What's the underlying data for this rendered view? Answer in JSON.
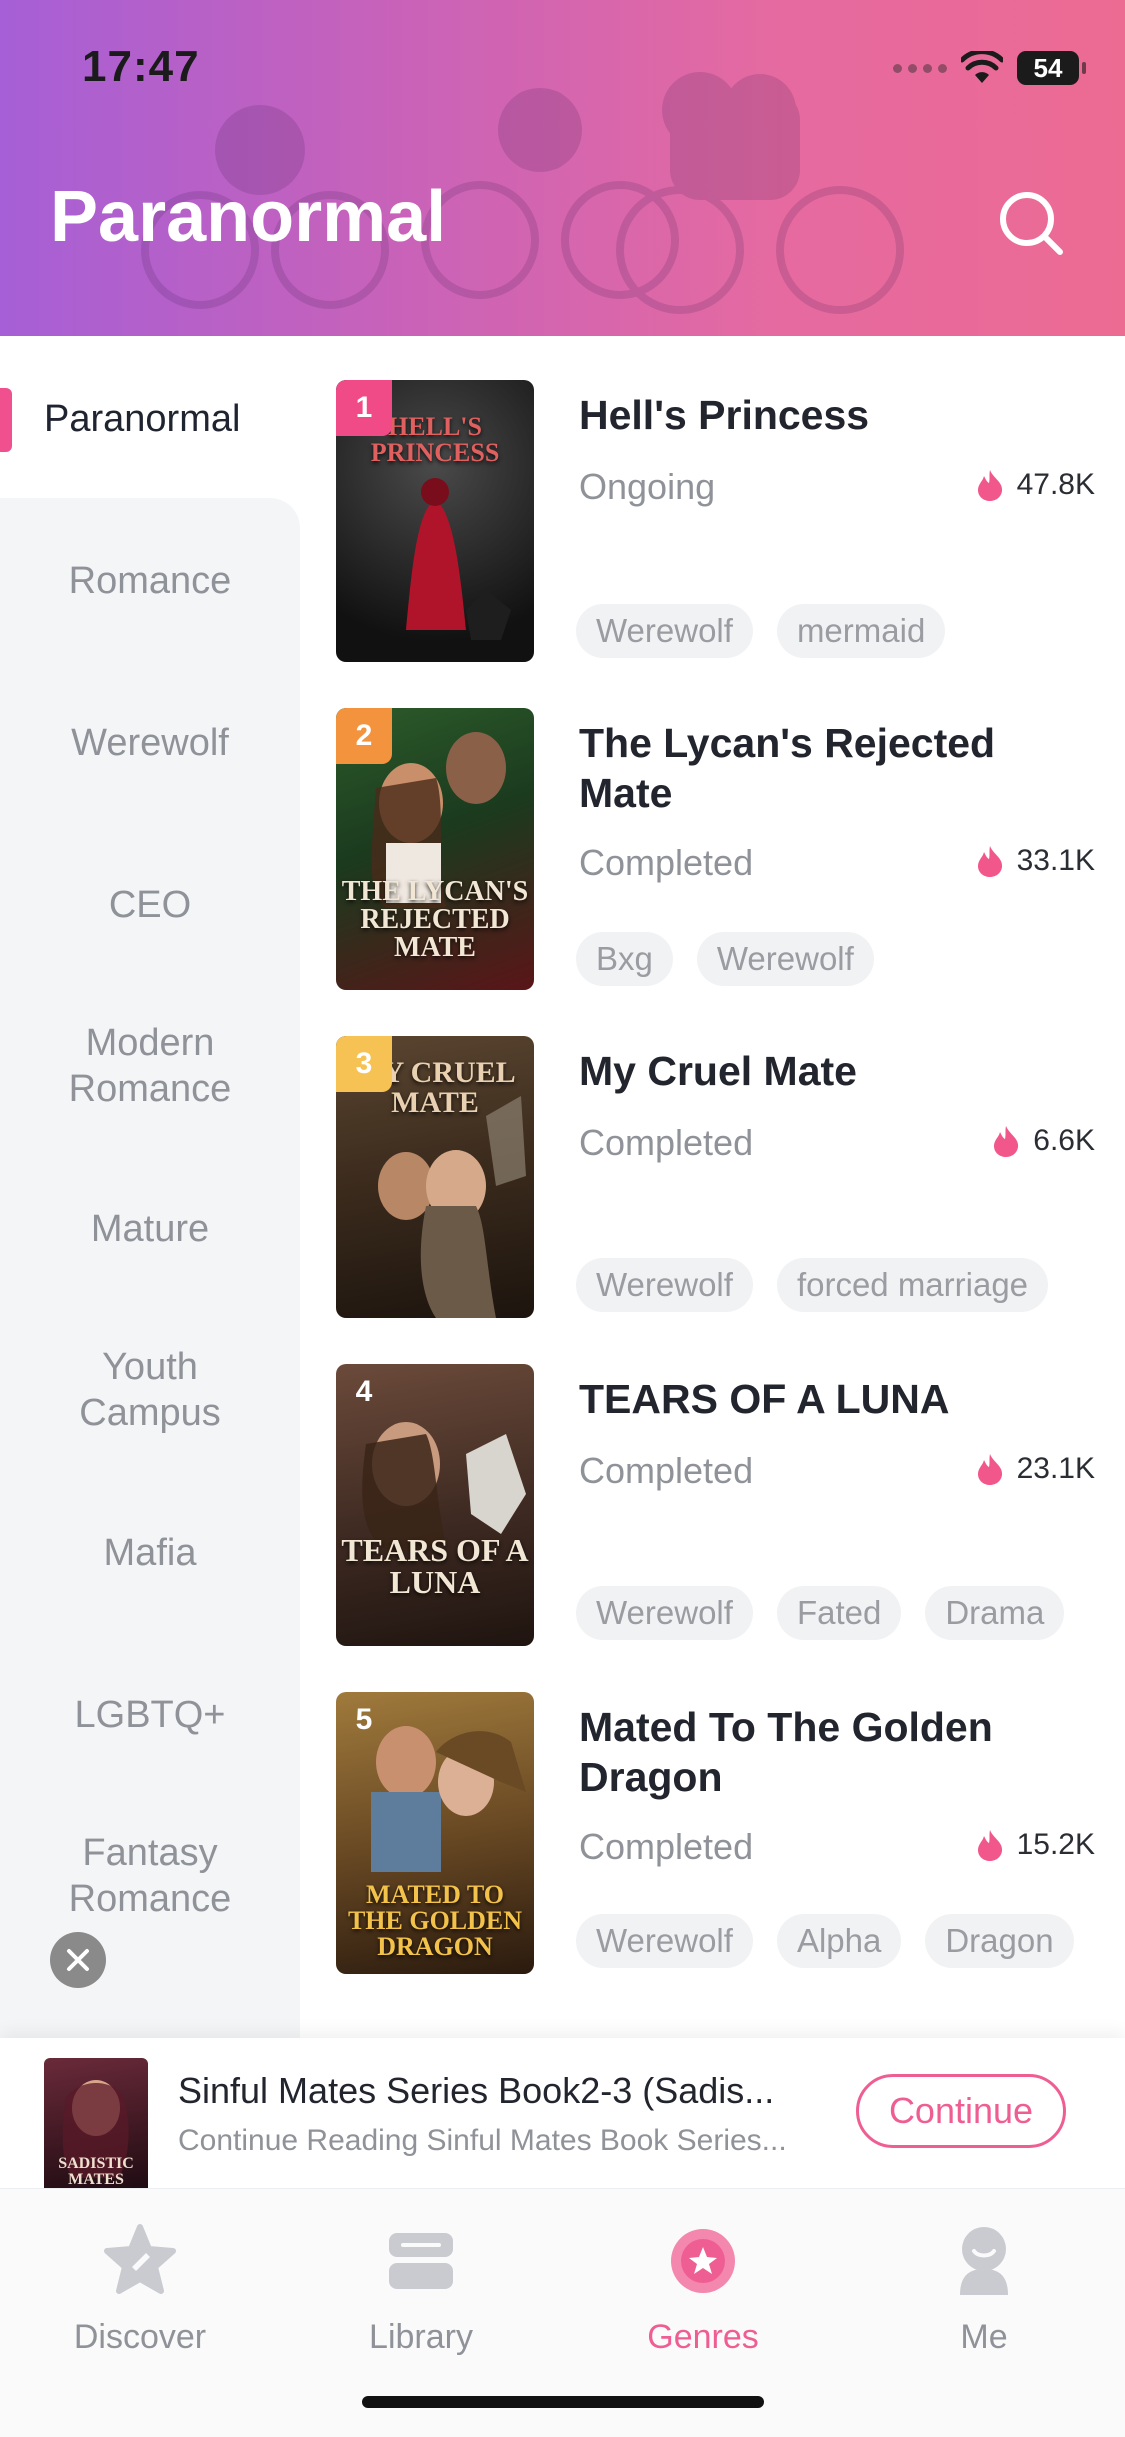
{
  "status_bar": {
    "time": "17:47",
    "battery": "54"
  },
  "header": {
    "title": "Paranormal"
  },
  "sidebar": {
    "active": "Paranormal",
    "items": [
      "Romance",
      "Werewolf",
      "CEO",
      "Modern Romance",
      "Mature",
      "Youth Campus",
      "Mafia",
      "LGBTQ+",
      "Fantasy Romance"
    ]
  },
  "books": [
    {
      "rank": "1",
      "title": "Hell's Princess",
      "status": "Ongoing",
      "views": "47.8K",
      "tags": [
        "Werewolf",
        "mermaid"
      ],
      "cover_text": "HELL'S PRINCESS",
      "rank_color": "#f04b86"
    },
    {
      "rank": "2",
      "title": "The Lycan's Rejected Mate",
      "status": "Completed",
      "views": "33.1K",
      "tags": [
        "Bxg",
        "Werewolf"
      ],
      "cover_text": "THE LYCAN'S REJECTED MATE",
      "rank_color": "#f3933e"
    },
    {
      "rank": "3",
      "title": "My Cruel Mate",
      "status": "Completed",
      "views": "6.6K",
      "tags": [
        "Werewolf",
        "forced marriage"
      ],
      "cover_text": "MY CRUEL MATE",
      "rank_color": "#f6c253"
    },
    {
      "rank": "4",
      "title": "TEARS OF A LUNA",
      "status": "Completed",
      "views": "23.1K",
      "tags": [
        "Werewolf",
        "Fated",
        "Drama"
      ],
      "cover_text": "TEARS OF A LUNA",
      "rank_color": ""
    },
    {
      "rank": "5",
      "title": "Mated To The Golden Dragon",
      "status": "Completed",
      "views": "15.2K",
      "tags": [
        "Werewolf",
        "Alpha",
        "Dragon"
      ],
      "cover_text": "MATED TO THE GOLDEN DRAGON",
      "rank_color": ""
    }
  ],
  "continue_reading": {
    "title": "Sinful Mates Series Book2-3 (Sadis...",
    "subtitle": "Continue Reading Sinful Mates Book Series...",
    "button": "Continue",
    "cover_text": "SADISTIC MATES"
  },
  "tabbar": {
    "items": [
      {
        "label": "Discover",
        "icon": "discover-icon"
      },
      {
        "label": "Library",
        "icon": "library-icon"
      },
      {
        "label": "Genres",
        "icon": "genres-icon"
      },
      {
        "label": "Me",
        "icon": "me-icon"
      }
    ],
    "active": "Genres"
  },
  "colors": {
    "accent": "#ef5e93",
    "header_start": "#a65fd6",
    "header_end": "#ec6b93"
  }
}
